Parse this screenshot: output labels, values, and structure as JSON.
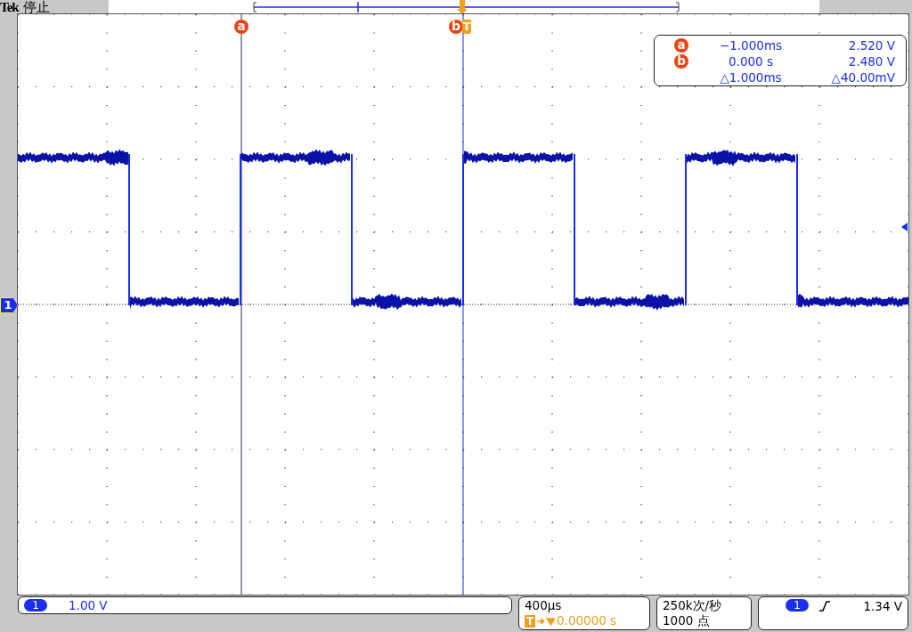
{
  "header": {
    "brand": "Tek",
    "status": "停止"
  },
  "markers": [
    {
      "label": "a"
    },
    {
      "label": "b"
    }
  ],
  "trigger_marker": {
    "label": "T"
  },
  "channel_marker": {
    "label": "1"
  },
  "readout": {
    "cursors": [
      {
        "label": "a",
        "time": "−1.000ms",
        "voltage": "2.520 V"
      },
      {
        "label": "b",
        "time": "0.000 s",
        "voltage": "2.480 V"
      }
    ],
    "delta": {
      "time": "△1.000ms",
      "voltage": "△40.00mV"
    }
  },
  "status_bar": {
    "channel": {
      "number": "1",
      "scale": "1.00 V"
    },
    "timebase": {
      "scale": "400µs",
      "trigger_label": "T",
      "delay": "0.00000 s"
    },
    "acquisition": {
      "sample_rate": "250k次/秒",
      "record_length": "1000 点"
    },
    "trigger": {
      "source": "1",
      "kind": "rising",
      "level": "1.34 V"
    }
  }
}
